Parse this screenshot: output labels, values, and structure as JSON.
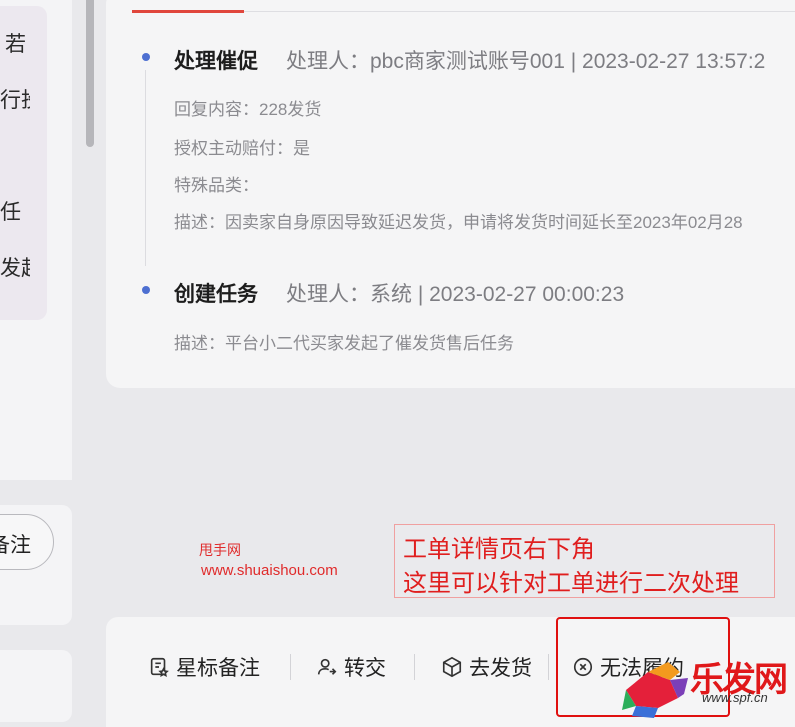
{
  "left_panel": {
    "fragments": [
      "若",
      "行投",
      "任",
      "发起"
    ],
    "note_button": "备注"
  },
  "timeline": [
    {
      "title": "处理催促",
      "meta": "处理人：pbc商家测试账号001 | 2023-02-27 13:57:2",
      "details": [
        "回复内容：228发货",
        "授权主动赔付：是",
        "特殊品类：",
        "描述：因卖家自身原因导致延迟发货，申请将发货时间延长至2023年02月28"
      ]
    },
    {
      "title": "创建任务",
      "meta": "处理人：系统 | 2023-02-27 00:00:23",
      "details": [
        "描述：平台小二代买家发起了催发货售后任务"
      ]
    }
  ],
  "watermark": {
    "line1": "甩手网",
    "line2": "www.shuaishou.com"
  },
  "annotation": {
    "line1": "工单详情页右下角",
    "line2": "这里可以针对工单进行二次处理"
  },
  "actions": [
    {
      "label": "星标备注",
      "icon": "star-note-icon"
    },
    {
      "label": "转交",
      "icon": "transfer-user-icon"
    },
    {
      "label": "去发货",
      "icon": "package-icon"
    },
    {
      "label": "无法履约",
      "icon": "circle-x-icon"
    }
  ],
  "logo": {
    "text": "乐发网",
    "site": "www.spf.cn"
  },
  "colors": {
    "accent": "#e0463c",
    "timeline_dot": "#4d6fd1",
    "annotation_red": "#e01e1e"
  }
}
